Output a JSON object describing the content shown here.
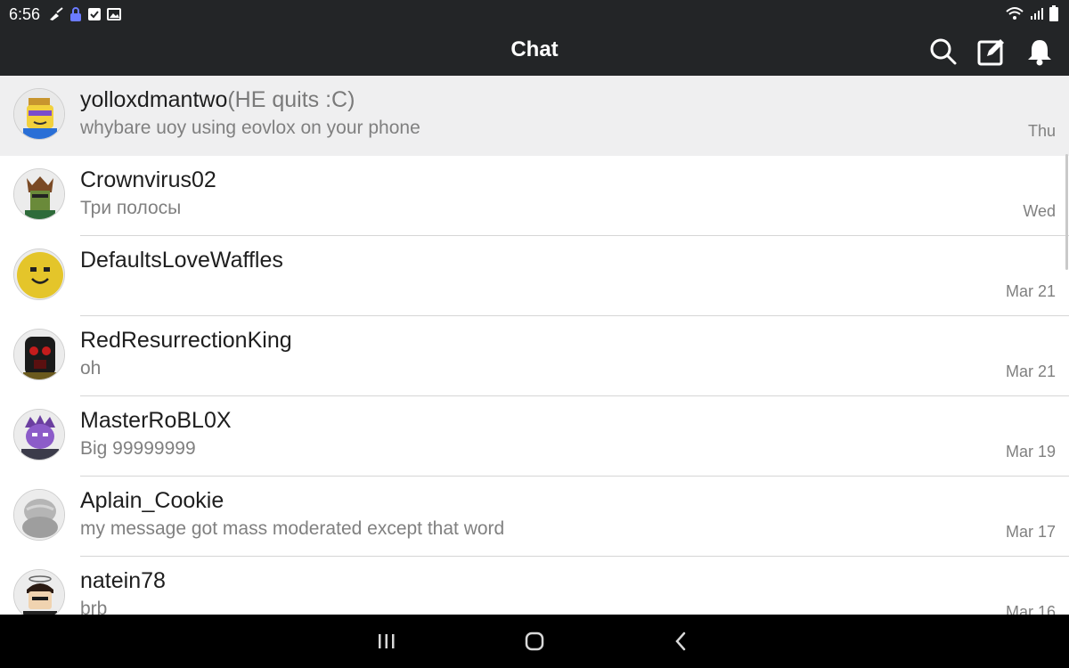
{
  "status_bar": {
    "time": "6:56"
  },
  "app_bar": {
    "title": "Chat",
    "icons": [
      "search-icon",
      "compose-icon",
      "bell-icon"
    ]
  },
  "chats": [
    {
      "name": "yolloxdmantwo",
      "name_suffix": "(HE quits :C)",
      "preview": "whybare uoy using eovlox on your phone",
      "time": "Thu",
      "selected": true
    },
    {
      "name": "Crownvirus02",
      "name_suffix": "",
      "preview": "Три полосы",
      "time": "Wed"
    },
    {
      "name": "DefaultsLoveWaffles",
      "name_suffix": "",
      "preview": "",
      "time": "Mar 21"
    },
    {
      "name": "RedResurrectionKing",
      "name_suffix": "",
      "preview": "oh",
      "time": "Mar 21"
    },
    {
      "name": "MasterRoBL0X",
      "name_suffix": "",
      "preview": "Big 99999999",
      "time": "Mar 19"
    },
    {
      "name": "Aplain_Cookie",
      "name_suffix": "",
      "preview": "my message got mass moderated except that word",
      "time": "Mar 17"
    },
    {
      "name": "natein78",
      "name_suffix": "",
      "preview": "brb",
      "time": "Mar 16"
    }
  ],
  "nav_bar": {
    "icons": [
      "recent-apps-icon",
      "home-icon",
      "back-icon"
    ]
  },
  "colors": {
    "bar_background": "#232527",
    "selected_row": "#efeff0",
    "secondary_text": "#808080"
  }
}
